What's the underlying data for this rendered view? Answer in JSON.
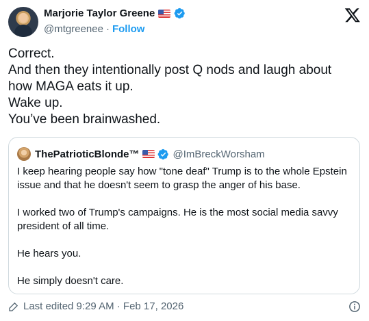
{
  "author": {
    "display_name": "Marjorie Taylor Greene",
    "handle": "@mtgreenee",
    "separator": "·",
    "follow_label": "Follow",
    "flag_icon": "us-flag-icon",
    "verified_icon": "verified-badge-icon"
  },
  "brand": {
    "icon": "x-logo-icon"
  },
  "tweet": {
    "lines": [
      "Correct.",
      "And then they intentionally post Q nods and laugh about",
      "how MAGA eats it up.",
      "Wake up.",
      "You’ve been brainwashed."
    ]
  },
  "quote": {
    "display_name": "ThePatrioticBlonde™",
    "handle": "@ImBreckWorsham",
    "paragraphs": [
      "I keep hearing people say how \"tone deaf\" Trump is to the whole Epstein issue and that he doesn't seem to grasp the anger of his base.",
      "I worked two of Trump's campaigns. He is the most social media savvy president of all time.",
      "He hears you.",
      "He simply doesn't care."
    ]
  },
  "footer": {
    "edited_text": "Last edited 9:29 AM · Feb 17, 2026",
    "edit_icon": "pencil-icon",
    "info_icon": "info-icon"
  },
  "colors": {
    "accent": "#1d9bf0",
    "text": "#0f1419",
    "secondary": "#536471",
    "border": "#cfd9de"
  }
}
